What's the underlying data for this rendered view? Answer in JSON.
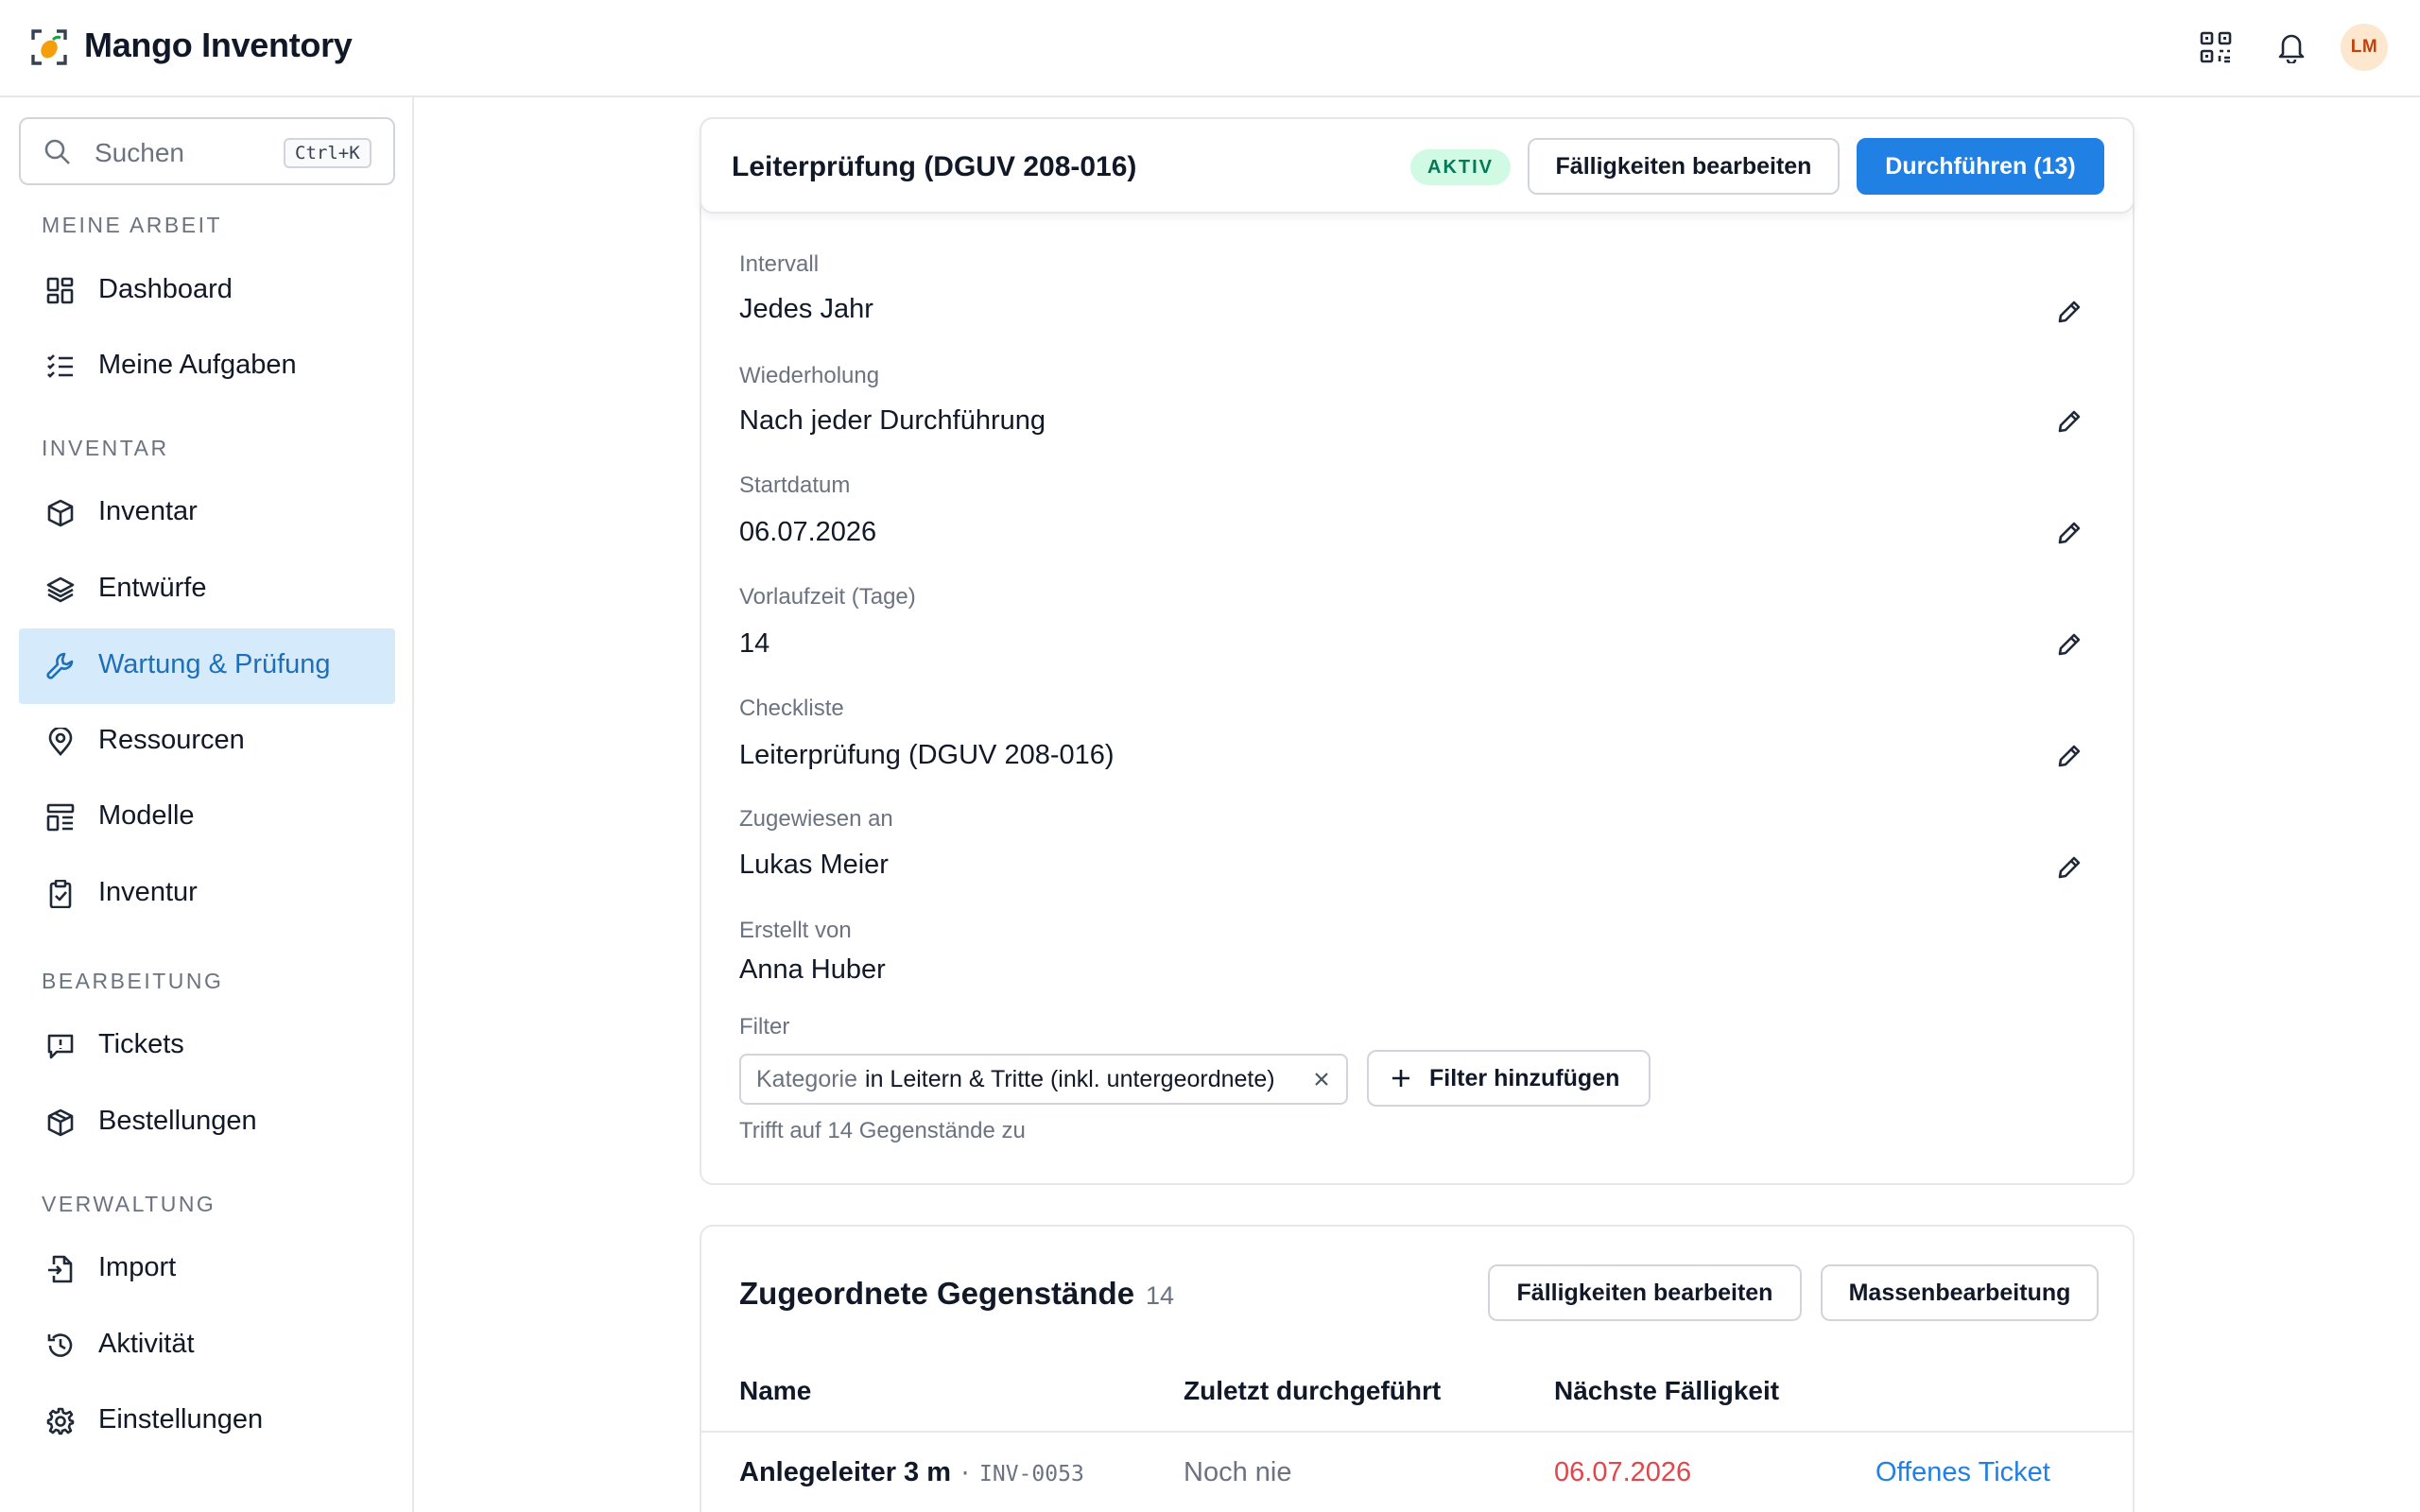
{
  "app": {
    "title": "Mango Inventory"
  },
  "topbar": {
    "avatar_initials": "LM",
    "icons": [
      "qr-code-icon",
      "bell-icon"
    ]
  },
  "sidebar": {
    "search": {
      "placeholder": "Suchen",
      "shortcut": "Ctrl+K"
    },
    "sections": [
      {
        "label": "MEINE ARBEIT",
        "items": [
          {
            "label": "Dashboard",
            "icon": "dashboard-icon"
          },
          {
            "label": "Meine Aufgaben",
            "icon": "checklist-icon"
          }
        ]
      },
      {
        "label": "INVENTAR",
        "items": [
          {
            "label": "Inventar",
            "icon": "cube-icon"
          },
          {
            "label": "Entwürfe",
            "icon": "layers-icon"
          },
          {
            "label": "Wartung & Prüfung",
            "icon": "wrench-icon",
            "active": true
          },
          {
            "label": "Ressourcen",
            "icon": "location-pin-icon"
          },
          {
            "label": "Modelle",
            "icon": "template-icon"
          },
          {
            "label": "Inventur",
            "icon": "clipboard-check-icon"
          }
        ]
      },
      {
        "label": "BEARBEITUNG",
        "items": [
          {
            "label": "Tickets",
            "icon": "ticket-message-icon"
          },
          {
            "label": "Bestellungen",
            "icon": "package-icon"
          }
        ]
      },
      {
        "label": "VERWALTUNG",
        "items": [
          {
            "label": "Import",
            "icon": "file-import-icon"
          },
          {
            "label": "Aktivität",
            "icon": "history-icon"
          },
          {
            "label": "Einstellungen",
            "icon": "gear-icon"
          }
        ]
      }
    ]
  },
  "plan": {
    "title": "Leiterprüfung (DGUV 208-016)",
    "status": "AKTIV",
    "edit_due_label": "Fälligkeiten bearbeiten",
    "execute_label": "Durchführen (13)",
    "fields": [
      {
        "label": "Intervall",
        "value": "Jedes Jahr"
      },
      {
        "label": "Wiederholung",
        "value": "Nach jeder Durchführung"
      },
      {
        "label": "Startdatum",
        "value": "06.07.2026"
      },
      {
        "label": "Vorlaufzeit (Tage)",
        "value": "14"
      },
      {
        "label": "Checkliste",
        "value": "Leiterprüfung (DGUV 208-016)"
      },
      {
        "label": "Zugewiesen an",
        "value": "Lukas Meier"
      },
      {
        "label": "Erstellt von",
        "value": "Anna Huber"
      }
    ],
    "filter": {
      "label": "Filter",
      "chip_key": "Kategorie",
      "chip_value": "in Leitern & Tritte (inkl. untergeordnete)",
      "add_label": "Filter hinzufügen",
      "match_text": "Trifft auf 14 Gegenstände zu"
    }
  },
  "assigned": {
    "title": "Zugeordnete Gegenstände",
    "count": "14",
    "edit_due_label": "Fälligkeiten bearbeiten",
    "bulk_edit_label": "Massenbearbeitung",
    "columns": [
      "Name",
      "Zuletzt durchgeführt",
      "Nächste Fälligkeit"
    ],
    "rows": [
      {
        "name": "Anlegeleiter 3 m",
        "code_sep": "·",
        "code": "INV-0053",
        "last": "Noch nie",
        "next": "06.07.2026",
        "action": "Offenes Ticket"
      }
    ]
  },
  "colors": {
    "accent": "#2180e3",
    "active_nav_bg": "#d5ebfb",
    "overdue": "#e0474c",
    "badge_bg": "#d1fae5",
    "badge_text": "#047857"
  }
}
